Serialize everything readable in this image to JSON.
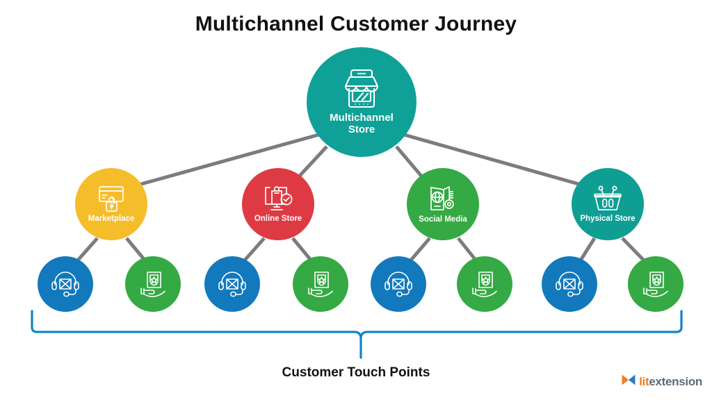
{
  "title": "Multichannel Customer Journey",
  "colors": {
    "teal": "#0fa197",
    "teal_dark": "#0f9e94",
    "yellow": "#f6bd2b",
    "red": "#de3a43",
    "green": "#35a943",
    "blue": "#1279bd",
    "connector_gray": "#7c7c7c",
    "brace_blue": "#1583c4",
    "text_dark": "#111111",
    "logo_orange": "#f47b20",
    "logo_blue": "#5b6b78"
  },
  "root_node": {
    "label_line1": "Multichannel",
    "label_line2": "Store",
    "icon": "storefront-icon",
    "color": "#0fa197"
  },
  "channels": [
    {
      "id": "marketplace",
      "label": "Marketplace",
      "icon": "credit-card-lock-icon",
      "color": "#f6bd2b"
    },
    {
      "id": "online-store",
      "label": "Online Store",
      "icon": "monitor-bag-check-icon",
      "color": "#de3a43"
    },
    {
      "id": "social-media",
      "label": "Social Media",
      "icon": "passport-globe-key-icon",
      "color": "#35a943"
    },
    {
      "id": "physical-store",
      "label": "Physical Store",
      "icon": "shopping-basket-icon",
      "color": "#0f9e94"
    }
  ],
  "touchpoints": [
    {
      "id": "tp-1",
      "icon": "headset-support-icon",
      "color": "#1279bd"
    },
    {
      "id": "tp-2",
      "icon": "hand-shield-star-icon",
      "color": "#35a943"
    },
    {
      "id": "tp-3",
      "icon": "headset-support-icon",
      "color": "#1279bd"
    },
    {
      "id": "tp-4",
      "icon": "hand-shield-star-icon",
      "color": "#35a943"
    },
    {
      "id": "tp-5",
      "icon": "headset-support-icon",
      "color": "#1279bd"
    },
    {
      "id": "tp-6",
      "icon": "hand-shield-star-icon",
      "color": "#35a943"
    },
    {
      "id": "tp-7",
      "icon": "headset-support-icon",
      "color": "#1279bd"
    },
    {
      "id": "tp-8",
      "icon": "hand-shield-star-icon",
      "color": "#35a943"
    }
  ],
  "brace": {
    "label": "Customer Touch Points",
    "color": "#1583c4"
  },
  "logo": {
    "text_primary": "lit",
    "text_secondary": "extension",
    "mark": "bowtie-logo-icon"
  }
}
